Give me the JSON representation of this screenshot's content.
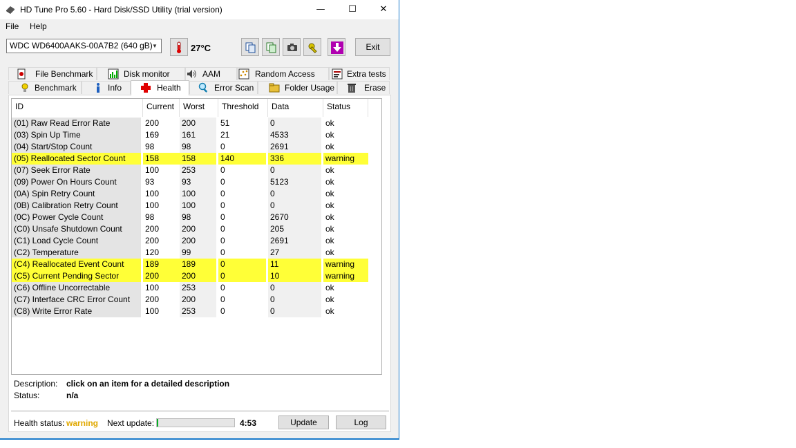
{
  "window": {
    "title": "HD Tune Pro 5.60 - Hard Disk/SSD Utility (trial version)"
  },
  "menu": [
    "File",
    "Help"
  ],
  "toolbar": {
    "drive": "WDC WD6400AAKS-00A7B2 (640 gB)",
    "temperature": "27°C",
    "exit_label": "Exit"
  },
  "tabs_row1": [
    {
      "label": "File Benchmark",
      "icon": "file-benchmark-icon"
    },
    {
      "label": "Disk monitor",
      "icon": "disk-monitor-icon"
    },
    {
      "label": "AAM",
      "icon": "speaker-icon"
    },
    {
      "label": "Random Access",
      "icon": "random-access-icon"
    },
    {
      "label": "Extra tests",
      "icon": "extra-tests-icon"
    }
  ],
  "tabs_row2": [
    {
      "label": "Benchmark",
      "icon": "benchmark-icon"
    },
    {
      "label": "Info",
      "icon": "info-icon"
    },
    {
      "label": "Health",
      "icon": "health-cross-icon",
      "active": true
    },
    {
      "label": "Error Scan",
      "icon": "magnifier-icon"
    },
    {
      "label": "Folder Usage",
      "icon": "folder-icon"
    },
    {
      "label": "Erase",
      "icon": "trash-icon"
    }
  ],
  "table": {
    "headers": [
      "ID",
      "Current",
      "Worst",
      "Threshold",
      "Data",
      "Status"
    ],
    "rows": [
      [
        "(01) Raw Read Error Rate",
        "200",
        "200",
        "51",
        "0",
        "ok"
      ],
      [
        "(03) Spin Up Time",
        "169",
        "161",
        "21",
        "4533",
        "ok"
      ],
      [
        "(04) Start/Stop Count",
        "98",
        "98",
        "0",
        "2691",
        "ok"
      ],
      [
        "(05) Reallocated Sector Count",
        "158",
        "158",
        "140",
        "336",
        "warning"
      ],
      [
        "(07) Seek Error Rate",
        "100",
        "253",
        "0",
        "0",
        "ok"
      ],
      [
        "(09) Power On Hours Count",
        "93",
        "93",
        "0",
        "5123",
        "ok"
      ],
      [
        "(0A) Spin Retry Count",
        "100",
        "100",
        "0",
        "0",
        "ok"
      ],
      [
        "(0B) Calibration Retry Count",
        "100",
        "100",
        "0",
        "0",
        "ok"
      ],
      [
        "(0C) Power Cycle Count",
        "98",
        "98",
        "0",
        "2670",
        "ok"
      ],
      [
        "(C0) Unsafe Shutdown Count",
        "200",
        "200",
        "0",
        "205",
        "ok"
      ],
      [
        "(C1) Load Cycle Count",
        "200",
        "200",
        "0",
        "2691",
        "ok"
      ],
      [
        "(C2) Temperature",
        "120",
        "99",
        "0",
        "27",
        "ok"
      ],
      [
        "(C4) Reallocated Event Count",
        "189",
        "189",
        "0",
        "11",
        "warning"
      ],
      [
        "(C5) Current Pending Sector",
        "200",
        "200",
        "0",
        "10",
        "warning"
      ],
      [
        "(C6) Offline Uncorrectable",
        "100",
        "253",
        "0",
        "0",
        "ok"
      ],
      [
        "(C7) Interface CRC Error Count",
        "200",
        "200",
        "0",
        "0",
        "ok"
      ],
      [
        "(C8) Write Error Rate",
        "100",
        "253",
        "0",
        "0",
        "ok"
      ]
    ]
  },
  "description": {
    "label": "Description:",
    "value": "click on an item for a detailed description",
    "status_label": "Status:",
    "status_value": "n/a"
  },
  "footer": {
    "health_label": "Health status:",
    "health_value": "warning",
    "next_update_label": "Next update:",
    "progress_fraction": 0.02,
    "countdown": "4:53",
    "update_label": "Update",
    "log_label": "Log"
  },
  "colors": {
    "warning_row": "#ffff37",
    "warning_text": "#e0a800",
    "accent": "#1979ca"
  }
}
